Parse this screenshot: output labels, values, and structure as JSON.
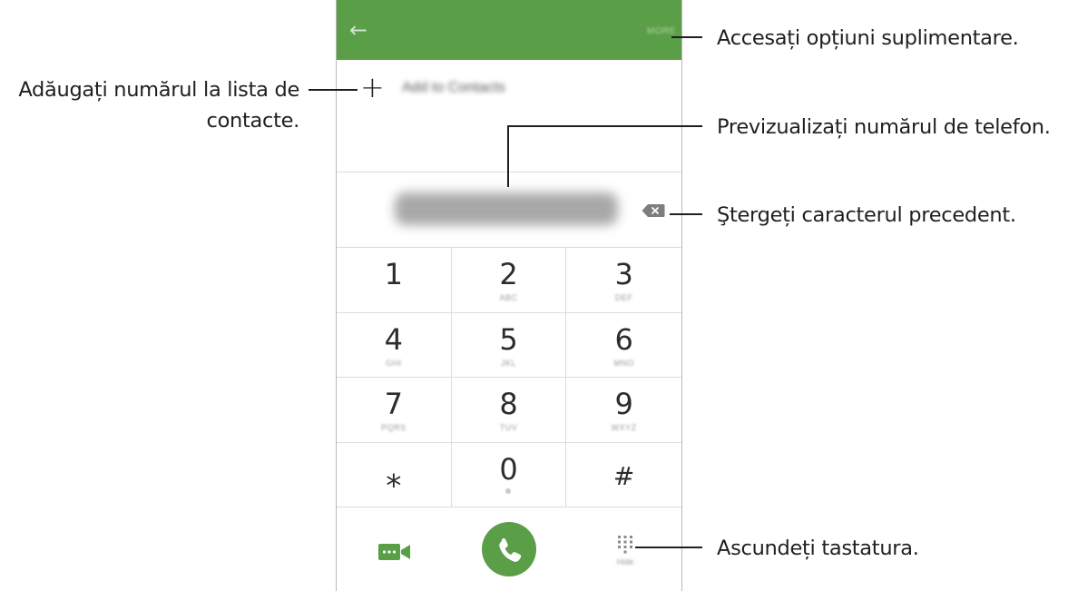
{
  "screen": {
    "more_label": "MORE",
    "add_contact_label": "Add to Contacts",
    "keys": [
      {
        "digit": "1",
        "letters": "",
        "dot": false
      },
      {
        "digit": "2",
        "letters": "ABC",
        "dot": false
      },
      {
        "digit": "3",
        "letters": "DEF",
        "dot": false
      },
      {
        "digit": "4",
        "letters": "GHI",
        "dot": false
      },
      {
        "digit": "5",
        "letters": "JKL",
        "dot": false
      },
      {
        "digit": "6",
        "letters": "MNO",
        "dot": false
      },
      {
        "digit": "7",
        "letters": "PQRS",
        "dot": false
      },
      {
        "digit": "8",
        "letters": "TUV",
        "dot": false
      },
      {
        "digit": "9",
        "letters": "WXYZ",
        "dot": false
      },
      {
        "digit": "⁎",
        "letters": "",
        "dot": false
      },
      {
        "digit": "0",
        "letters": "",
        "dot": true
      },
      {
        "digit": "#",
        "letters": "",
        "dot": false
      }
    ],
    "keypad_toggle_label": "Hide",
    "icons": {
      "back": "back-arrow-icon",
      "add": "plus-icon",
      "delete": "backspace-icon",
      "video": "video-call-icon",
      "call": "phone-icon",
      "keypad": "dialpad-icon"
    },
    "colors": {
      "app_bar": "#5a9e47",
      "call_button": "#5a9e47",
      "video_icon": "#5a9e47"
    }
  },
  "annotations": {
    "more_options": "Accesați opțiuni suplimentare.",
    "add_contact_line1": "Adăugați numărul la lista de",
    "add_contact_line2": "contacte.",
    "preview_number": "Previzualizați numărul de telefon.",
    "delete_char": "Ştergeți caracterul precedent.",
    "hide_keypad": "Ascundeți tastatura."
  }
}
